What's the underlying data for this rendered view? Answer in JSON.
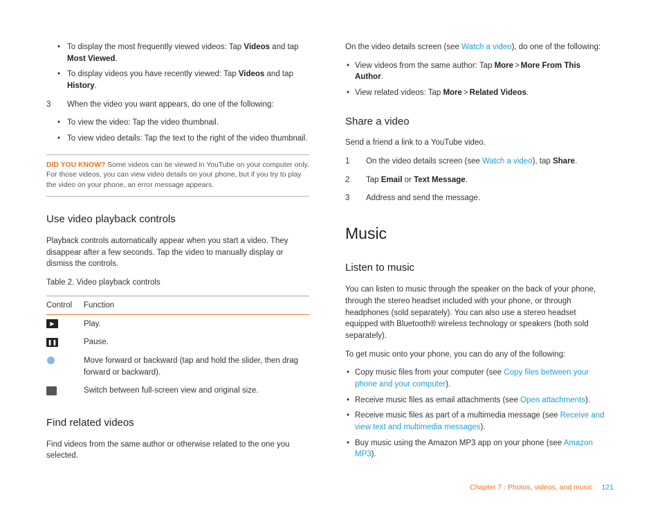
{
  "left": {
    "intro_bullets": [
      {
        "pre": "To display the most frequently viewed videos: Tap ",
        "b1": "Videos",
        "mid": " and tap ",
        "b2": "Most Viewed",
        "post": "."
      },
      {
        "pre": "To display videos you have recently viewed: Tap ",
        "b1": "Videos",
        "mid": " and tap ",
        "b2": "History",
        "post": "."
      }
    ],
    "step3": {
      "num": "3",
      "text": "When the video you want appears, do one of the following:"
    },
    "step3_bullets": [
      "To view the video: Tap the video thumbnail.",
      "To view video details: Tap the text to the right of the video thumbnail."
    ],
    "callout": {
      "lead": "DID YOU KNOW?",
      "body": "Some videos can be viewed in YouTube on your computer only. For those videos, you can view video details on your phone, but if you try to play the video on your phone, an error message appears."
    },
    "sec_playback": "Use video playback controls",
    "playback_p": "Playback controls automatically appear when you start a video. They disappear after a few seconds. Tap the video to manually display or dismiss the controls.",
    "table_caption": "Table 2. Video playback controls",
    "table_h1": "Control",
    "table_h2": "Function",
    "rows": {
      "play": "Play.",
      "pause": "Pause.",
      "slider": "Move forward or backward (tap and hold the slider, then drag forward or backward).",
      "fs": "Switch between full-screen view and original size."
    },
    "sec_related": "Find related videos",
    "related_p": "Find videos from the same author or otherwise related to the one you selected."
  },
  "right": {
    "details_intro_pre": "On the video details screen (see ",
    "details_intro_link": "Watch a video",
    "details_intro_post": "), do one of the following:",
    "details_bullets": [
      {
        "pre": "View videos from the same author: Tap ",
        "b1": "More",
        "gt": ">",
        "b2": "More From This Author",
        "post": "."
      },
      {
        "pre": "View related videos: Tap ",
        "b1": "More",
        "gt": ">",
        "b2": "Related Videos",
        "post": "."
      }
    ],
    "sec_share": "Share a video",
    "share_p": "Send a friend a link to a YouTube video.",
    "share_steps": {
      "s1_num": "1",
      "s1_pre": "On the video details screen (see ",
      "s1_link": "Watch a video",
      "s1_mid": "), tap ",
      "s1_b": "Share",
      "s1_post": ".",
      "s2_num": "2",
      "s2_pre": "Tap ",
      "s2_b1": "Email",
      "s2_or": " or ",
      "s2_b2": "Text Message",
      "s2_post": ".",
      "s3_num": "3",
      "s3_text": "Address and send the message."
    },
    "h_music": "Music",
    "sec_listen": "Listen to music",
    "listen_p1": "You can listen to music through the speaker on the back of your phone, through the stereo headset included with your phone, or through headphones (sold separately). You can also use a stereo headset equipped with Bluetooth® wireless technology or speakers (both sold separately).",
    "listen_p2": "To get music onto your phone, you can do any of the following:",
    "music_bullets": {
      "b1_pre": "Copy music files from your computer (see ",
      "b1_link": "Copy files between your phone and your computer",
      "b1_post": ").",
      "b2_pre": "Receive music files as email attachments (see ",
      "b2_link": "Open attachments",
      "b2_post": ").",
      "b3_pre": "Receive music files as part of a multimedia message (see ",
      "b3_link": "Receive and view text and multimedia messages",
      "b3_post": ").",
      "b4_pre": "Buy music using the Amazon MP3 app on your phone (see ",
      "b4_link": "Amazon MP3",
      "b4_post": ")."
    }
  },
  "footer": {
    "chapter": "Chapter 7 : Photos, videos, and music",
    "page": "121"
  },
  "icons": {
    "play": "▶",
    "pause": "❚❚"
  }
}
